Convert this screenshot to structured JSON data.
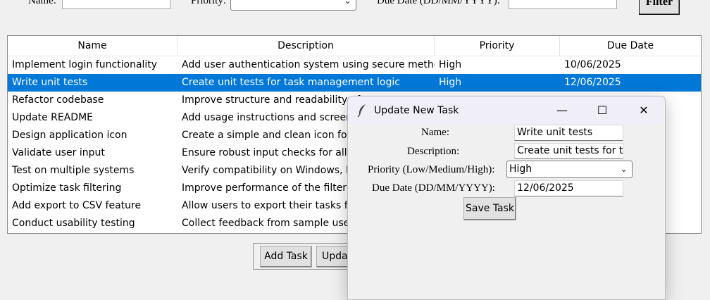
{
  "filter": {
    "name_label": "Name:",
    "priority_label": "Priority:",
    "due_date_label": "Due Date (DD/MM/YYYY):",
    "button_label": "Filter"
  },
  "table": {
    "columns": [
      "Name",
      "Description",
      "Priority",
      "Due Date"
    ],
    "selected_index": 1,
    "rows": [
      {
        "name": "Implement login functionality",
        "description": "Add user authentication system using secure methods",
        "priority": "High",
        "due": "10/06/2025"
      },
      {
        "name": "Write unit tests",
        "description": "Create unit tests for task management logic",
        "priority": "High",
        "due": "12/06/2025"
      },
      {
        "name": "Refactor codebase",
        "description": "Improve structure and readability of",
        "priority": "",
        "due": ""
      },
      {
        "name": "Update README",
        "description": "Add usage instructions and screensh",
        "priority": "",
        "due": ""
      },
      {
        "name": "Design application icon",
        "description": "Create a simple and clean icon for th",
        "priority": "",
        "due": ""
      },
      {
        "name": "Validate user input",
        "description": "Ensure robust input checks for all ta",
        "priority": "",
        "due": ""
      },
      {
        "name": "Test on multiple systems",
        "description": "Verify compatibility on Windows, M",
        "priority": "",
        "due": ""
      },
      {
        "name": "Optimize task filtering",
        "description": "Improve performance of the filter fe",
        "priority": "",
        "due": ""
      },
      {
        "name": "Add export to CSV feature",
        "description": "Allow users to export their tasks for",
        "priority": "",
        "due": ""
      },
      {
        "name": "Conduct usability testing",
        "description": "Collect feedback from sample users",
        "priority": "",
        "due": ""
      }
    ]
  },
  "buttons": {
    "add_task": "Add Task",
    "update_task": "Upda"
  },
  "dialog": {
    "title": "Update New Task",
    "minimize": "—",
    "maximize": "☐",
    "close": "✕",
    "name_label": "Name:",
    "description_label": "Description:",
    "priority_label": "Priority (Low/Medium/High):",
    "due_date_label": "Due Date (DD/MM/YYYY):",
    "name_value": "Write unit tests",
    "description_value": "Create unit tests for tas",
    "priority_value": "High",
    "due_date_value": "12/06/2025",
    "save_label": "Save Task"
  },
  "colors": {
    "selection": "#0078d7",
    "window_bg": "#f0f0f0"
  }
}
